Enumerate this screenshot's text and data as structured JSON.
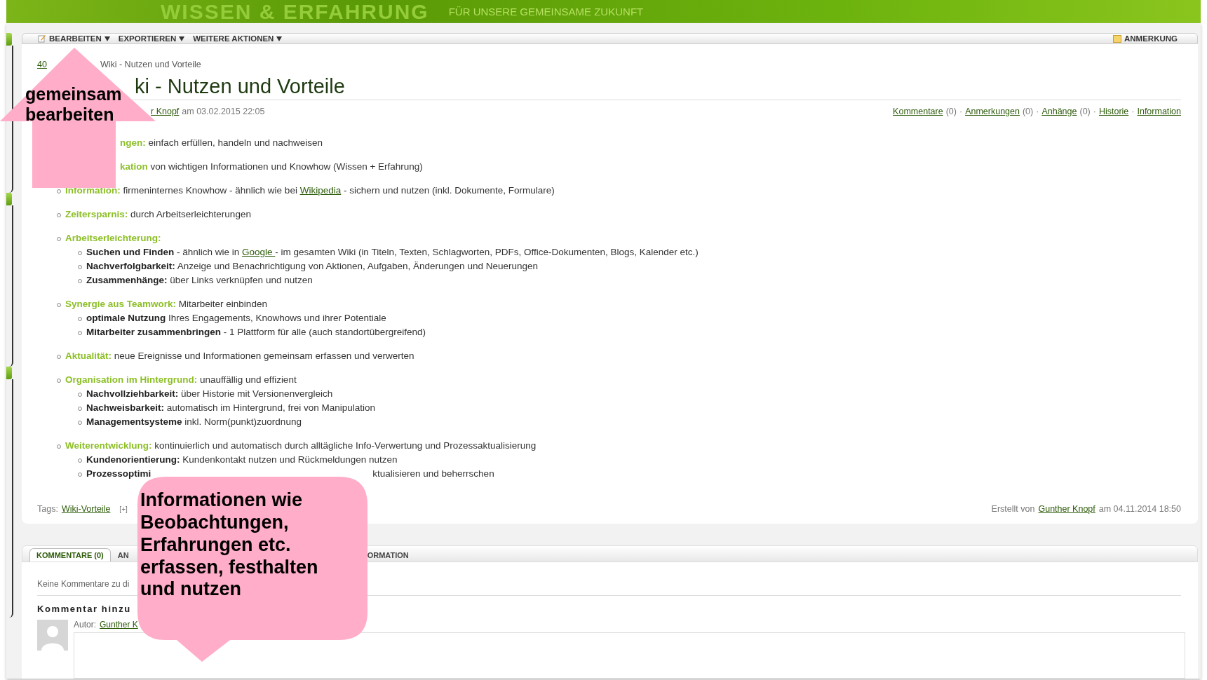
{
  "banner": {
    "title": "WISSEN & ERFAHRUNG",
    "tagline": "FÜR UNSERE GEMEINSAME ZUKUNFT"
  },
  "toolbar": {
    "items": [
      {
        "label": "BEARBEITEN",
        "menu": true
      },
      {
        "label": "EXPORTIEREN",
        "menu": true
      },
      {
        "label": "WEITERE AKTIONEN",
        "menu": true
      }
    ],
    "right": {
      "label": "ANMERKUNG"
    }
  },
  "breadcrumb": {
    "link": "40",
    "rest": "Wiki - Nutzen und Vorteile"
  },
  "title": "ki - Nutzen und Vorteile",
  "meta": {
    "author_link": "r Knopf",
    "date": "am 03.02.2015 22:05",
    "links": [
      {
        "label": "Kommentare",
        "count": "(0)"
      },
      {
        "sep": "·",
        "label": "Anmerkungen",
        "count": "(0)"
      },
      {
        "sep": "·",
        "label": "Anhänge",
        "count": "(0)"
      },
      {
        "sep": "·",
        "label": "Historie"
      },
      {
        "sep": "·",
        "label": "Information"
      }
    ]
  },
  "items": [
    {
      "kind": "covered",
      "label": "ngen:",
      "parts": [
        {
          "text": "einfach erfüllen, handeln und nachweisen"
        }
      ]
    },
    {
      "kind": "covered",
      "label": "kation",
      "parts": [
        {
          "text": "von wichtigen Informationen und Knowhow (Wissen + Erfahrung)"
        }
      ]
    },
    {
      "kind": "plain",
      "label": "Information:",
      "parts": [
        {
          "text": "firmeninternes Knowhow - ähnlich wie bei "
        },
        {
          "link": "Wikipedia"
        },
        {
          "text": " - sichern und nutzen (inkl. Dokumente, Formulare)"
        }
      ]
    },
    {
      "kind": "plain",
      "label": "Zeitersparnis:",
      "parts": [
        {
          "text": "durch Arbeitserleichterungen"
        }
      ]
    },
    {
      "kind": "plain",
      "label": "Arbeitserleichterung:",
      "children": [
        {
          "kind": "plain",
          "label": "Suchen und Finden",
          "parts": [
            {
              "text": " - ähnlich wie in "
            },
            {
              "link": "Google "
            },
            {
              "text": " - im gesamten Wiki (in Titeln, Texten, Schlagworten, PDFs, Office-Dokumenten, Blogs, Kalender etc.)"
            }
          ]
        },
        {
          "kind": "plain",
          "label": "Nachverfolgbarkeit:",
          "parts": [
            {
              "text": "Anzeige und Benachrichtigung von Aktionen, Aufgaben, Änderungen und Neuerungen"
            }
          ]
        },
        {
          "kind": "plain",
          "label": "Zusammenhänge:",
          "parts": [
            {
              "text": "über Links verknüpfen und nutzen"
            }
          ]
        }
      ]
    },
    {
      "kind": "plain",
      "label": "Synergie aus Teamwork:",
      "parts": [
        {
          "text": "Mitarbeiter einbinden"
        }
      ],
      "children": [
        {
          "kind": "plain",
          "label": "optimale Nutzung",
          "parts": [
            {
              "text": "Ihres Engagements, Knowhows und ihrer Potentiale"
            }
          ]
        },
        {
          "kind": "plain",
          "label": "Mitarbeiter zusammenbringen",
          "parts": [
            {
              "text": " - 1 Plattform für alle (auch standortübergreifend)"
            }
          ]
        }
      ]
    },
    {
      "kind": "plain",
      "label": "Aktualität:",
      "parts": [
        {
          "text": "neue Ereignisse und Informationen gemeinsam erfassen und verwerten"
        }
      ]
    },
    {
      "kind": "plain",
      "label": "Organisation im Hintergrund:",
      "parts": [
        {
          "text": "unauffällig und effizient"
        }
      ],
      "children": [
        {
          "kind": "plain",
          "label": "Nachvollziehbarkeit:",
          "parts": [
            {
              "text": "über Historie mit Versionenvergleich"
            }
          ]
        },
        {
          "kind": "plain",
          "label": "Nachweisbarkeit:",
          "parts": [
            {
              "text": "automatisch im Hintergrund, frei von Manipulation"
            }
          ]
        },
        {
          "kind": "plain",
          "label": "Managementsysteme",
          "parts": [
            {
              "text": "inkl. Norm(punkt)zuordnung"
            }
          ]
        }
      ]
    },
    {
      "kind": "plain",
      "label": "Weiterentwicklung:",
      "parts": [
        {
          "text": " kontinuierlich und automatisch durch alltägliche Info-Verwertung und Prozessaktualisierung"
        }
      ],
      "children": [
        {
          "kind": "plain",
          "label": "Kundenorientierung:",
          "parts": [
            {
              "text": "Kundenkontakt nutzen und Rückmeldungen nutzen"
            }
          ]
        },
        {
          "kind": "split",
          "label": "Prozessoptimi",
          "parts": [
            {
              "text": "ktualisieren und beherrschen"
            }
          ]
        }
      ]
    }
  ],
  "tags": {
    "label": "Tags:",
    "link": "Wiki-Vorteile",
    "add": "[+]"
  },
  "created": {
    "prefix": "Erstellt von",
    "link": "Gunther Knopf",
    "date": "am 04.11.2014 18:50"
  },
  "tabs": [
    {
      "label": "KOMMENTARE (0)",
      "selected": true
    },
    {
      "label": "AN",
      "selected": false
    },
    {
      "label": "ORMATION",
      "selected": false
    }
  ],
  "comments": {
    "empty": "Keine Kommentare zu di",
    "heading": "Kommentar hinzu",
    "author_label": "Autor:",
    "author_link": "Gunther K"
  },
  "callouts": [
    {
      "kind": "arrow",
      "text": "gemeinsam bearbeiten"
    },
    {
      "kind": "bubble",
      "text": "Informationen wie Beobachtungen, Erfahrungen etc. erfassen, festhalten und nutzen"
    }
  ]
}
